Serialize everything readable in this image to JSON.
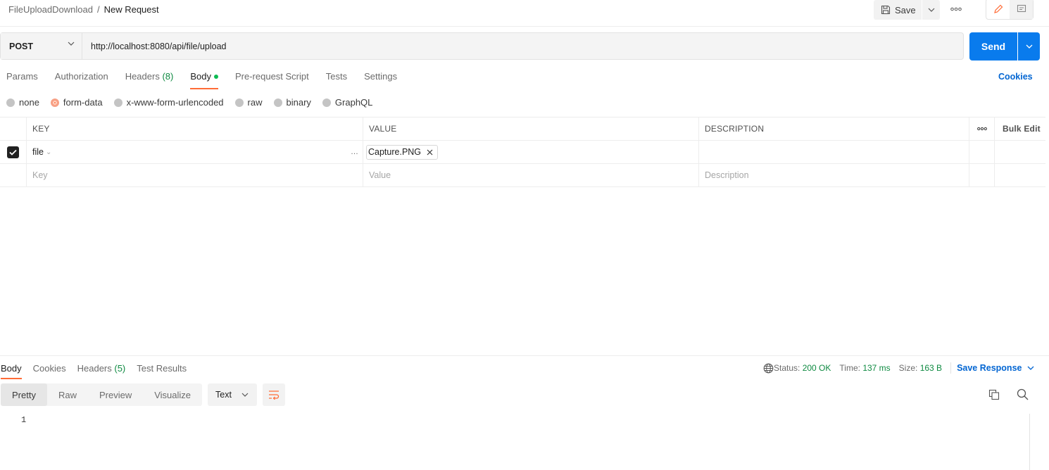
{
  "header": {
    "collection": "FileUploadDownload",
    "separator": "/",
    "request_name": "New Request",
    "save_label": "Save"
  },
  "request": {
    "method": "POST",
    "url": "http://localhost:8080/api/file/upload",
    "send_label": "Send"
  },
  "tabs": {
    "params": "Params",
    "authorization": "Authorization",
    "headers": "Headers",
    "headers_count": "(8)",
    "body": "Body",
    "prerequest": "Pre-request Script",
    "tests": "Tests",
    "settings": "Settings",
    "cookies": "Cookies"
  },
  "body_types": {
    "none": "none",
    "form_data": "form-data",
    "urlencoded": "x-www-form-urlencoded",
    "raw": "raw",
    "binary": "binary",
    "graphql": "GraphQL",
    "selected": "form-data"
  },
  "form_table": {
    "headers": {
      "key": "KEY",
      "value": "VALUE",
      "description": "DESCRIPTION",
      "bulk_edit": "Bulk Edit"
    },
    "row": {
      "key": "file",
      "file_name": "Capture.PNG",
      "checked": true
    },
    "placeholders": {
      "key": "Key",
      "value": "Value",
      "description": "Description"
    }
  },
  "response": {
    "tabs": {
      "body": "Body",
      "cookies": "Cookies",
      "headers": "Headers",
      "headers_count": "(5)",
      "test_results": "Test Results"
    },
    "status_label": "Status:",
    "status_value": "200 OK",
    "time_label": "Time:",
    "time_value": "137 ms",
    "size_label": "Size:",
    "size_value": "163 B",
    "save_response": "Save Response",
    "views": {
      "pretty": "Pretty",
      "raw": "Raw",
      "preview": "Preview",
      "visualize": "Visualize"
    },
    "format": "Text",
    "line_number": "1"
  },
  "colors": {
    "accent": "#ff6c37",
    "send": "#097bed",
    "link": "#0265d2",
    "success": "#0e8a41"
  }
}
